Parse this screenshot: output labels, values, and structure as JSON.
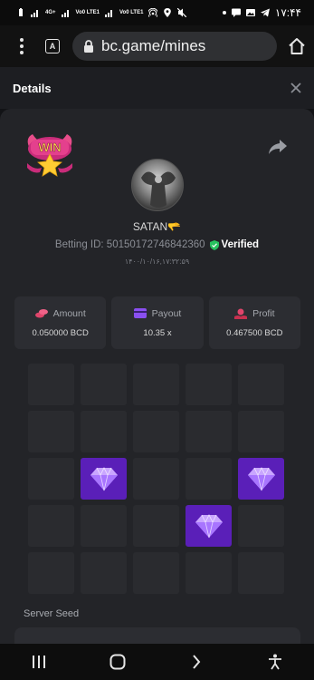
{
  "status_bar": {
    "time": "۱۷:۴۴",
    "network_labels": [
      "4G+",
      "Vo0 LTE1",
      "Vo0 LTE1"
    ]
  },
  "browser": {
    "url": "bc.game/mines",
    "tab_letter": "A"
  },
  "details": {
    "title": "Details"
  },
  "bet": {
    "username": "SATAN🫳",
    "betting_id_label": "Betting ID: 5015017274684236​0",
    "verified_label": "Verified",
    "datetime": "۱۴۰۰/۱۰/۱۶,۱۷:۳۲:۵۹"
  },
  "stats": [
    {
      "label": "Amount",
      "value": "0.050000 BCD",
      "icon": "coins-icon",
      "color": "#e0456b"
    },
    {
      "label": "Payout",
      "value": "10.35 x",
      "icon": "card-icon",
      "color": "#8a4ff0"
    },
    {
      "label": "Profit",
      "value": "0.467500 BCD",
      "icon": "money-hand-icon",
      "color": "#e0456b"
    }
  ],
  "grid": {
    "rows": 5,
    "cols": 5,
    "gems": [
      [
        2,
        1
      ],
      [
        2,
        4
      ],
      [
        3,
        3
      ]
    ]
  },
  "seed": {
    "label": "Server Seed"
  },
  "colors": {
    "gem_tile": "#5a1fb8",
    "tile": "#2a2b2f",
    "verified": "#27c25f"
  }
}
